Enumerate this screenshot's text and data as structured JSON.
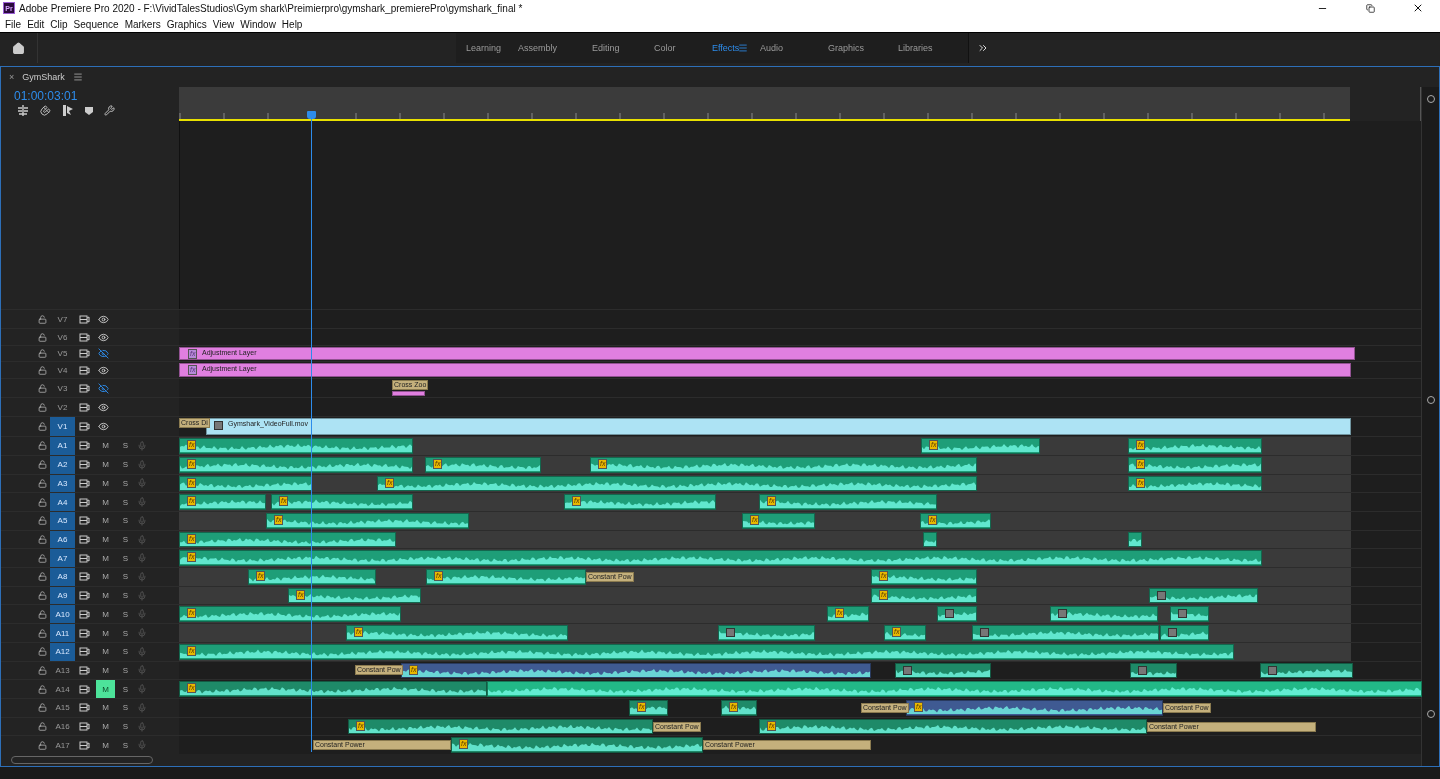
{
  "window": {
    "app_logo": "Pr",
    "title": "Adobe Premiere Pro 2020 - F:\\VividTalesStudios\\Gym shark\\Preimierpro\\gymshark_premierePro\\gymshark_final *"
  },
  "menu": [
    "File",
    "Edit",
    "Clip",
    "Sequence",
    "Markers",
    "Graphics",
    "View",
    "Window",
    "Help"
  ],
  "workspaces": [
    {
      "label": "Learning",
      "selected": false
    },
    {
      "label": "Assembly",
      "selected": false
    },
    {
      "label": "Editing",
      "selected": false
    },
    {
      "label": "Color",
      "selected": false
    },
    {
      "label": "Effects",
      "selected": true
    },
    {
      "label": "Audio",
      "selected": false
    },
    {
      "label": "Graphics",
      "selected": false
    },
    {
      "label": "Libraries",
      "selected": false
    }
  ],
  "timeline": {
    "close": "×",
    "sequence": "GymShark",
    "timecode": "01:00:03:01",
    "tracks": [
      {
        "name": "V7",
        "kind": "video",
        "targeted": false,
        "visible": true
      },
      {
        "name": "V6",
        "kind": "video",
        "targeted": false,
        "visible": true
      },
      {
        "name": "V5",
        "kind": "video",
        "targeted": false,
        "visible": false,
        "clips": [
          {
            "kind": "adjustment",
            "label": "Adjustment Layer",
            "badge": "fx"
          }
        ]
      },
      {
        "name": "V4",
        "kind": "video",
        "targeted": false,
        "visible": true,
        "clips": [
          {
            "kind": "adjustment",
            "label": "Adjustment Layer",
            "badge": "fx"
          }
        ]
      },
      {
        "name": "V3",
        "kind": "video",
        "targeted": false,
        "visible": false,
        "clips": [
          {
            "kind": "adjustment"
          },
          {
            "kind": "transition",
            "label": "Cross Zoo"
          }
        ]
      },
      {
        "name": "V2",
        "kind": "video",
        "targeted": false,
        "visible": true
      },
      {
        "name": "V1",
        "kind": "video",
        "targeted": true,
        "visible": true,
        "clips": [
          {
            "kind": "transition",
            "label": "Cross Di"
          },
          {
            "kind": "video",
            "label": "Gymshark_VideoFull.mov",
            "icon": true
          }
        ]
      },
      {
        "name": "A1",
        "kind": "audio",
        "targeted": true,
        "mute": "M",
        "solo": "S",
        "muted": false,
        "clips": [
          {
            "kind": "audio",
            "color": "#1e9e78",
            "badge": "fx"
          },
          {
            "kind": "audio",
            "color": "#1e9e78",
            "badge": "fx"
          },
          {
            "kind": "audio",
            "color": "#1e9e78",
            "badge": "fx"
          }
        ]
      },
      {
        "name": "A2",
        "kind": "audio",
        "targeted": true,
        "mute": "M",
        "solo": "S",
        "muted": false,
        "clips": [
          {
            "kind": "audio",
            "color": "#1e9e78",
            "badge": "fx"
          },
          {
            "kind": "audio",
            "color": "#1e9e78",
            "badge": "fx"
          },
          {
            "kind": "audio",
            "color": "#1e9e78",
            "badge": "fx"
          },
          {
            "kind": "audio",
            "color": "#1e9e78",
            "badge": "fx"
          }
        ]
      },
      {
        "name": "A3",
        "kind": "audio",
        "targeted": true,
        "mute": "M",
        "solo": "S",
        "muted": false,
        "clips": [
          {
            "kind": "audio",
            "color": "#1e9e78",
            "badge": "fx"
          },
          {
            "kind": "audio",
            "color": "#1e9e78",
            "badge": "fx"
          },
          {
            "kind": "audio",
            "color": "#1e9e78",
            "badge": "fx"
          }
        ]
      },
      {
        "name": "A4",
        "kind": "audio",
        "targeted": true,
        "mute": "M",
        "solo": "S",
        "muted": false,
        "clips": [
          {
            "kind": "audio",
            "color": "#1e9e78",
            "badge": "fx"
          },
          {
            "kind": "audio",
            "color": "#1e9e78",
            "badge": "fx"
          },
          {
            "kind": "audio",
            "color": "#1e9e78",
            "badge": "fx"
          },
          {
            "kind": "audio",
            "color": "#1e9e78",
            "badge": "fx"
          }
        ]
      },
      {
        "name": "A5",
        "kind": "audio",
        "targeted": true,
        "mute": "M",
        "solo": "S",
        "muted": false,
        "clips": [
          {
            "kind": "audio",
            "color": "#1e9e78",
            "badge": "fx"
          },
          {
            "kind": "audio",
            "color": "#1e9e78",
            "badge": "fx"
          },
          {
            "kind": "audio",
            "color": "#1e9e78",
            "badge": "fx"
          }
        ]
      },
      {
        "name": "A6",
        "kind": "audio",
        "targeted": true,
        "mute": "M",
        "solo": "S",
        "muted": false,
        "clips": [
          {
            "kind": "audio",
            "color": "#1e9e78",
            "badge": "fx"
          },
          {
            "kind": "audio",
            "color": "#1e9e78"
          },
          {
            "kind": "audio",
            "color": "#1e9e78"
          }
        ]
      },
      {
        "name": "A7",
        "kind": "audio",
        "targeted": true,
        "mute": "M",
        "solo": "S",
        "muted": false,
        "clips": [
          {
            "kind": "audio",
            "color": "#1e9e78",
            "badge": "fx"
          }
        ]
      },
      {
        "name": "A8",
        "kind": "audio",
        "targeted": true,
        "mute": "M",
        "solo": "S",
        "muted": false,
        "clips": [
          {
            "kind": "audio",
            "color": "#1e9e78",
            "badge": "fx"
          },
          {
            "kind": "audio",
            "color": "#1e9e78",
            "badge": "fx"
          },
          {
            "kind": "transition",
            "label": "Constant Pow"
          },
          {
            "kind": "audio",
            "color": "#1e9e78",
            "badge": "fx"
          }
        ]
      },
      {
        "name": "A9",
        "kind": "audio",
        "targeted": true,
        "mute": "M",
        "solo": "S",
        "muted": false,
        "clips": [
          {
            "kind": "audio",
            "color": "#1e9e78",
            "badge": "fx"
          },
          {
            "kind": "audio",
            "color": "#1e9e78",
            "badge": "fx"
          },
          {
            "kind": "audio",
            "color": "#1e9e78",
            "icon": true
          }
        ]
      },
      {
        "name": "A10",
        "kind": "audio",
        "targeted": true,
        "mute": "M",
        "solo": "S",
        "muted": false,
        "clips": [
          {
            "kind": "audio",
            "color": "#1e9e78",
            "badge": "fx"
          },
          {
            "kind": "audio",
            "color": "#1e9e78",
            "badge": "fx"
          },
          {
            "kind": "audio",
            "color": "#1e9e78",
            "icon": true
          },
          {
            "kind": "audio",
            "color": "#1e9e78",
            "icon": true
          },
          {
            "kind": "audio",
            "color": "#1e9e78",
            "icon": true
          }
        ]
      },
      {
        "name": "A11",
        "kind": "audio",
        "targeted": true,
        "mute": "M",
        "solo": "S",
        "muted": false,
        "clips": [
          {
            "kind": "audio",
            "color": "#1e9e78",
            "badge": "fx"
          },
          {
            "kind": "audio",
            "color": "#1e9e78",
            "icon": true
          },
          {
            "kind": "audio",
            "color": "#1e9e78",
            "badge": "fx"
          },
          {
            "kind": "audio",
            "color": "#1e9e78",
            "icon": true
          },
          {
            "kind": "audio",
            "color": "#1e9e78",
            "icon": true
          }
        ]
      },
      {
        "name": "A12",
        "kind": "audio",
        "targeted": true,
        "mute": "M",
        "solo": "S",
        "muted": false,
        "clips": [
          {
            "kind": "audio",
            "color": "#1e9e78",
            "badge": "fx"
          }
        ]
      },
      {
        "name": "A13",
        "kind": "audio",
        "targeted": false,
        "mute": "M",
        "solo": "S",
        "muted": false,
        "clips": [
          {
            "kind": "transition",
            "label": "Constant Pow"
          },
          {
            "kind": "audio",
            "color": "#3f5a92",
            "badge": "fx"
          },
          {
            "kind": "audio",
            "color": "#1e8a68",
            "icon": true
          },
          {
            "kind": "audio",
            "color": "#1e8a68",
            "icon": true
          },
          {
            "kind": "audio",
            "color": "#1e8a68",
            "icon": true
          }
        ]
      },
      {
        "name": "A14",
        "kind": "audio",
        "targeted": false,
        "mute": "M",
        "solo": "S",
        "muted": true,
        "clips": [
          {
            "kind": "audio",
            "color": "#1e8a68",
            "badge": "fx"
          },
          {
            "kind": "audio",
            "color": "#22b887"
          }
        ]
      },
      {
        "name": "A15",
        "kind": "audio",
        "targeted": false,
        "mute": "M",
        "solo": "S",
        "muted": false,
        "clips": [
          {
            "kind": "audio",
            "color": "#1e8a68",
            "badge": "fx"
          },
          {
            "kind": "audio",
            "color": "#1e8a68",
            "badge": "fx"
          },
          {
            "kind": "transition",
            "label": "Constant Pow"
          },
          {
            "kind": "audio",
            "color": "#3f5a92",
            "badge": "fx"
          },
          {
            "kind": "transition",
            "label": "Constant Pow"
          }
        ]
      },
      {
        "name": "A16",
        "kind": "audio",
        "targeted": false,
        "mute": "M",
        "solo": "S",
        "muted": false,
        "clips": [
          {
            "kind": "audio",
            "color": "#1e8a68",
            "badge": "fx"
          },
          {
            "kind": "transition",
            "label": "Constant Pow"
          },
          {
            "kind": "audio",
            "color": "#1e8a68",
            "badge": "fx"
          },
          {
            "kind": "transition",
            "label": "Constant Power"
          }
        ]
      },
      {
        "name": "A17",
        "kind": "audio",
        "targeted": false,
        "mute": "M",
        "solo": "S",
        "muted": false,
        "clips": [
          {
            "kind": "transition",
            "label": "Constant Power"
          },
          {
            "kind": "audio",
            "color": "#1e8a68",
            "badge": "fx"
          },
          {
            "kind": "transition",
            "label": "Constant Power"
          }
        ]
      }
    ]
  }
}
